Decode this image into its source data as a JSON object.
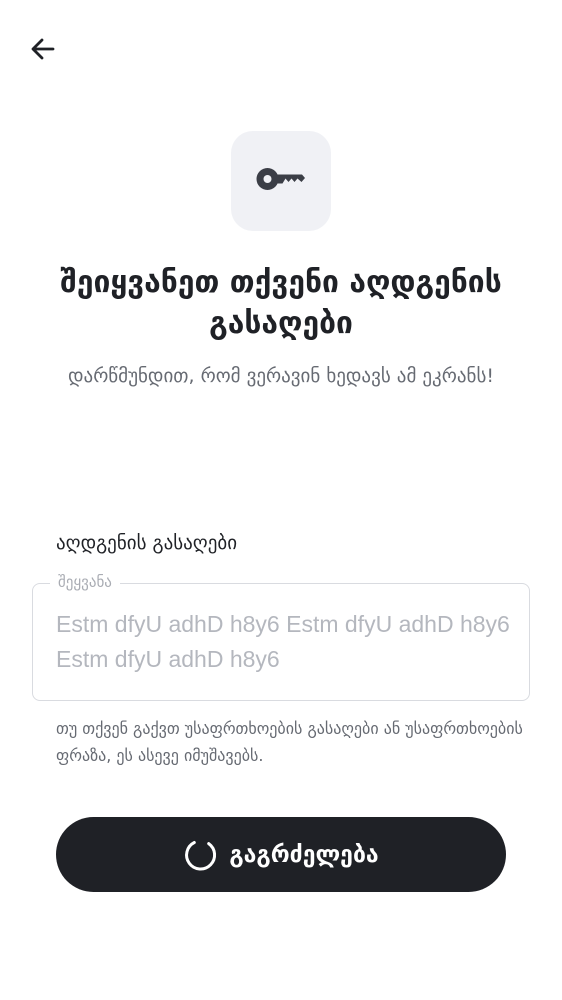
{
  "header": {
    "back_icon": "arrow-left-icon"
  },
  "hero": {
    "icon": "key-icon",
    "title": "შეიყვანეთ თქვენი აღდგენის გასაღები",
    "subtitle": "დარწმუნდით, რომ ვერავინ ხედავს ამ ეკრანს!"
  },
  "recovery_field": {
    "label": "აღდგენის გასაღები",
    "legend": "შეყვანა",
    "placeholder": "Estm dfyU adhD h8y6 Estm dfyU adhD h8y6 Estm dfyU adhD h8y6",
    "value": ""
  },
  "hint": "თუ თქვენ გაქვთ უსაფრთხოების გასაღები ან უსაფრთხოების ფრაზა, ეს ასევე იმუშავებს.",
  "continue_button": {
    "label": "გაგრძელება",
    "loading": true,
    "icon": "spinner-icon"
  },
  "colors": {
    "primary": "#1f2126",
    "tile_bg": "#f0f1f5",
    "key_icon": "#3b3e46",
    "muted_text": "#666a72",
    "border": "#d9dbe0"
  }
}
